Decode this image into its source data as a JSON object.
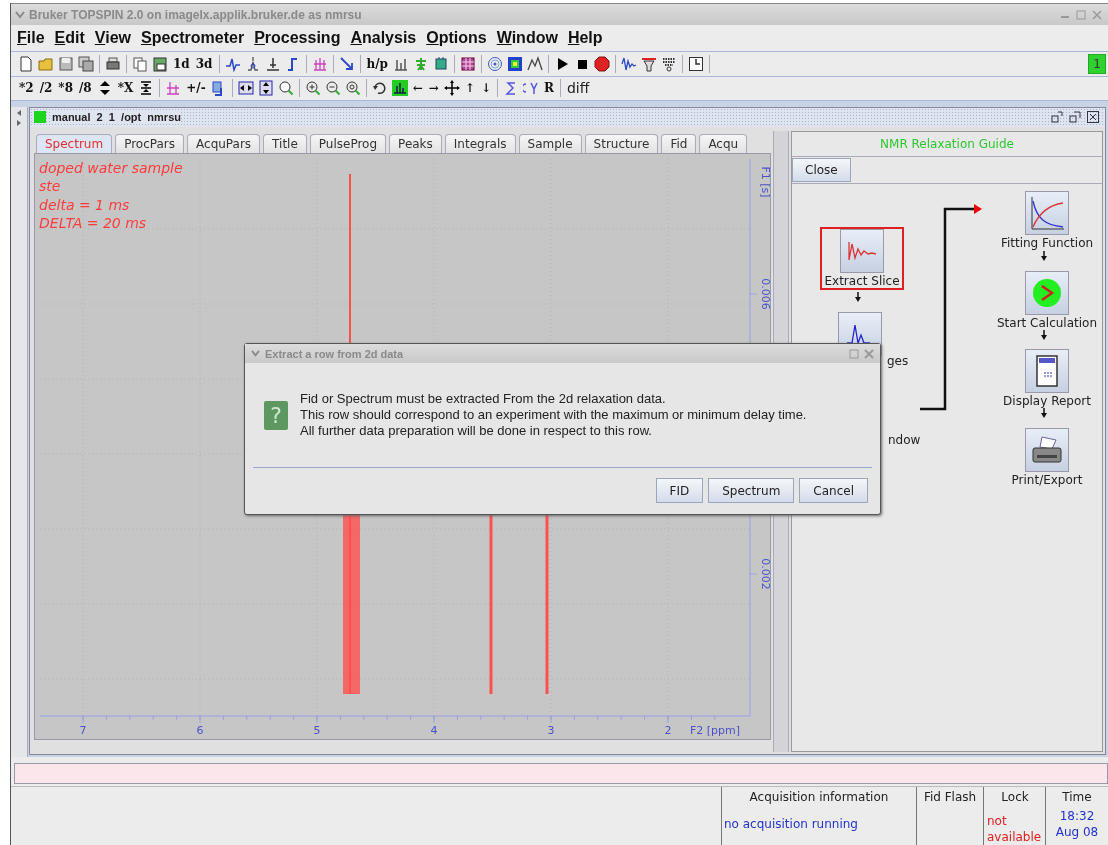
{
  "window": {
    "title": "Bruker TOPSPIN 2.0 on imagelx.applik.bruker.de as nmrsu"
  },
  "menu": [
    "File",
    "Edit",
    "View",
    "Spectrometer",
    "Processing",
    "Analysis",
    "Options",
    "Window",
    "Help"
  ],
  "toolbar_1": {
    "labels": [
      "1d",
      "3d",
      "h/p"
    ],
    "indicator": "1"
  },
  "toolbar_2": {
    "labels": [
      "*2",
      "/2",
      "*8",
      "/8",
      "*X",
      "+/-",
      "←",
      "→",
      "↑",
      "↓",
      "R",
      "diff"
    ]
  },
  "data_window": {
    "title": "manual  2  1  /opt  nmrsu",
    "tabs": [
      {
        "label": "Spectrum",
        "selected": true
      },
      {
        "label": "ProcPars",
        "selected": false
      },
      {
        "label": "AcquPars",
        "selected": false
      },
      {
        "label": "Title",
        "selected": false
      },
      {
        "label": "PulseProg",
        "selected": false
      },
      {
        "label": "Peaks",
        "selected": false
      },
      {
        "label": "Integrals",
        "selected": false
      },
      {
        "label": "Sample",
        "selected": false
      },
      {
        "label": "Structure",
        "selected": false
      },
      {
        "label": "Fid",
        "selected": false
      },
      {
        "label": "Acqu",
        "selected": false
      }
    ]
  },
  "spectrum": {
    "annotations": [
      "doped water sample",
      "ste",
      "delta = 1 ms",
      "DELTA = 20 ms"
    ],
    "x_ticks": [
      "7",
      "6",
      "5",
      "4",
      "3",
      "2"
    ],
    "x_label": "F2 [ppm]",
    "y_ticks": [
      "0.006",
      "0.002"
    ],
    "y_label": "F1 [s]"
  },
  "guide": {
    "title": "NMR Relaxation Guide",
    "close": "Close",
    "steps": [
      {
        "label": "Extract Slice",
        "selected": true
      },
      {
        "label": "ges",
        "selected": false
      },
      {
        "label": "ndow",
        "selected": false
      },
      {
        "label": "Fitting Function",
        "selected": false
      },
      {
        "label": "Start Calculation",
        "selected": false
      },
      {
        "label": "Display Report",
        "selected": false
      },
      {
        "label": "Print/Export",
        "selected": false
      }
    ]
  },
  "dialog": {
    "title": "Extract a row from 2d data",
    "icon": "?",
    "message": [
      "Fid or Spectrum must be extracted From the 2d relaxation data.",
      "This row should correspond to an experiment with the maximum or minimum delay time.",
      "All further data preparation will be done in respect to this row."
    ],
    "buttons": [
      "FID",
      "Spectrum",
      "Cancel"
    ]
  },
  "status_bar": {
    "acquisition": {
      "label": "Acquisition information",
      "value": "no acquisition running"
    },
    "fid_flash": {
      "label": "Fid Flash"
    },
    "lock": {
      "label": "Lock",
      "value": "not available"
    },
    "time": {
      "label": "Time",
      "clock": "18:32",
      "date": "Aug 08"
    }
  }
}
